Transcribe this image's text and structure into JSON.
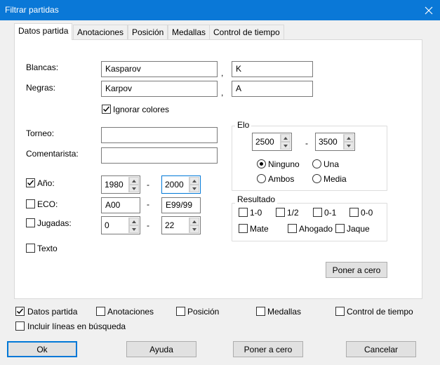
{
  "window": {
    "title": "Filtrar partidas"
  },
  "tabs": [
    "Datos partida",
    "Anotaciones",
    "Posición",
    "Medallas",
    "Control de tiempo"
  ],
  "players": {
    "white_label": "Blancas:",
    "white_value": "Kasparov",
    "white_extra": "K",
    "black_label": "Negras:",
    "black_value": "Karpov",
    "black_extra": "A",
    "comma": ",",
    "ignore_colors_label": "Ignorar colores"
  },
  "tournament": {
    "label": "Torneo:",
    "value": ""
  },
  "annotator": {
    "label": "Comentarista:",
    "value": ""
  },
  "year": {
    "label": "Año:",
    "from": "1980",
    "to": "2000"
  },
  "eco": {
    "label": "ECO:",
    "from": "A00",
    "to": "E99/99"
  },
  "moves": {
    "label": "Jugadas:",
    "from": "0",
    "to": "22"
  },
  "text": {
    "label": "Texto"
  },
  "dash": "-",
  "elo": {
    "title": "Elo",
    "from": "2500",
    "to": "3500",
    "options": [
      "Ninguno",
      "Una",
      "Ambos",
      "Media"
    ],
    "selected": "Ninguno"
  },
  "result": {
    "title": "Resultado",
    "options": [
      "1-0",
      "1/2",
      "0-1",
      "0-0",
      "Mate",
      "Ahogado",
      "Jaque"
    ]
  },
  "panel_reset_label": "Poner a cero",
  "bottom_checks": {
    "game_data": "Datos partida",
    "annotations": "Anotaciones",
    "position": "Posición",
    "medals": "Medallas",
    "time_control": "Control de tiempo",
    "include_lines": "Incluir líneas en búsqueda"
  },
  "buttons": {
    "ok": "Ok",
    "help": "Ayuda",
    "reset": "Poner a cero",
    "cancel": "Cancelar"
  }
}
